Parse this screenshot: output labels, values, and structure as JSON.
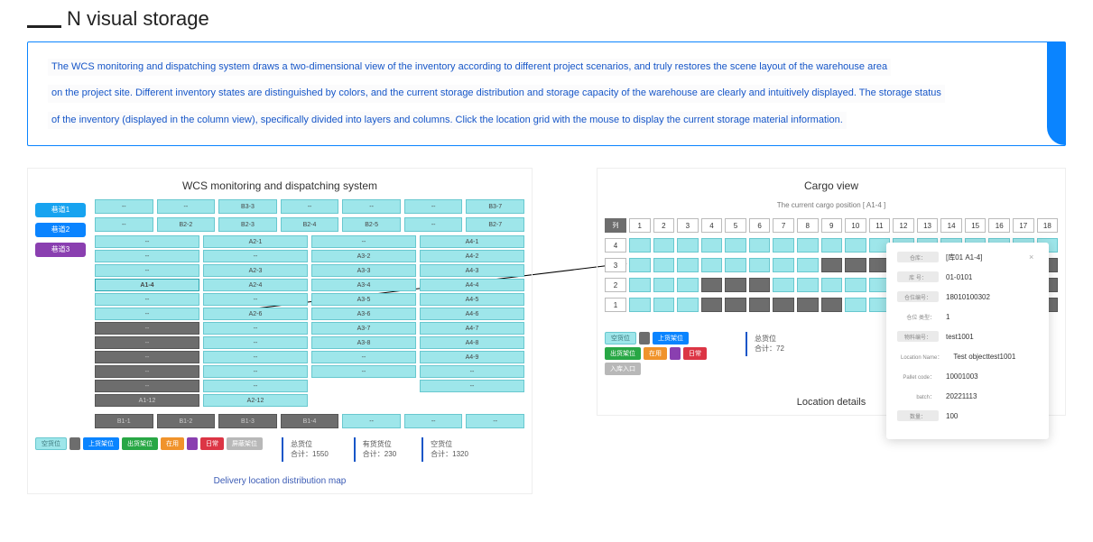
{
  "header": {
    "title": "N visual storage"
  },
  "description": {
    "line1": "The WCS monitoring and dispatching system draws a two-dimensional view of the inventory according to different project scenarios, and truly restores the scene layout of the warehouse area",
    "line2": "on the project site. Different inventory states are distinguished by colors, and the current storage distribution and storage capacity of the warehouse are clearly and intuitively displayed. The storage status",
    "line3": "of the inventory (displayed in the column view), specifically divided into layers and columns. Click the location grid with the mouse to display the current storage material information."
  },
  "left": {
    "title": "WCS monitoring and dispatching system",
    "zones": [
      "巷道1",
      "巷道2",
      "巷道3"
    ],
    "topRow1": [
      "--",
      "--",
      "B3-3",
      "--",
      "--",
      "--",
      "B3-7"
    ],
    "topRow2": [
      "--",
      "B2-2",
      "B2-3",
      "B2-4",
      "B2-5",
      "--",
      "B2-7"
    ],
    "col1": [
      "--",
      "--",
      "--",
      "A1-4",
      "--",
      "--",
      "--",
      "--",
      "--",
      "--",
      "--",
      "A1-12"
    ],
    "col1Gray": [
      false,
      false,
      false,
      false,
      false,
      false,
      true,
      true,
      true,
      true,
      true,
      true
    ],
    "col2": [
      "A2-1",
      "--",
      "A2-3",
      "A2-4",
      "--",
      "A2-6",
      "--",
      "--",
      "--",
      "--",
      "--",
      "A2-12"
    ],
    "col3": [
      "--",
      "A3-2",
      "A3-3",
      "A3-4",
      "A3-5",
      "A3-6",
      "A3-7",
      "A3-8",
      "--",
      "--"
    ],
    "col4": [
      "A4-1",
      "A4-2",
      "A4-3",
      "A4-4",
      "A4-5",
      "A4-6",
      "A4-7",
      "A4-8",
      "A4-9",
      "--",
      "--"
    ],
    "bottomRow": [
      "B1-1",
      "B1-2",
      "B1-3",
      "B1-4",
      "--",
      "--",
      "--"
    ],
    "legend": [
      "空货位",
      "",
      "上货架位",
      "出货架位",
      "在用",
      "",
      "日常",
      "屏蔽架位"
    ],
    "stats": [
      {
        "label": "总货位",
        "value": "合计：1550"
      },
      {
        "label": "有货货位",
        "value": "合计：230"
      },
      {
        "label": "空货位",
        "value": "合计：1320"
      }
    ],
    "caption": "Delivery location distribution map"
  },
  "right": {
    "title": "Cargo view",
    "subtitle": "The current cargo position [ A1-4 ]",
    "headerLabel": "列",
    "numbers": [
      "1",
      "2",
      "3",
      "4",
      "5",
      "6",
      "7",
      "8",
      "9",
      "10",
      "11",
      "12",
      "13",
      "14",
      "15",
      "16",
      "17",
      "18"
    ],
    "rows": [
      {
        "label": "4",
        "gray": [
          0,
          0,
          0,
          0,
          0,
          0,
          0,
          0,
          0,
          0,
          0,
          0,
          0,
          0,
          0,
          0,
          0,
          0
        ]
      },
      {
        "label": "3",
        "gray": [
          0,
          0,
          0,
          0,
          0,
          0,
          0,
          0,
          1,
          1,
          1,
          1,
          0,
          0,
          0,
          0,
          1,
          1
        ]
      },
      {
        "label": "2",
        "gray": [
          0,
          0,
          0,
          1,
          1,
          1,
          0,
          0,
          0,
          0,
          0,
          0,
          0,
          0,
          0,
          0,
          1,
          1
        ]
      },
      {
        "label": "1",
        "gray": [
          0,
          0,
          0,
          1,
          1,
          1,
          1,
          1,
          1,
          0,
          0,
          0,
          0,
          0,
          0,
          0,
          1,
          1
        ]
      }
    ],
    "legend": [
      "空货位",
      "",
      "上货架位",
      "出货架位",
      "在用",
      "",
      "日常",
      "入库入口"
    ],
    "stat": {
      "label": "总货位",
      "value": "合计：72"
    },
    "popup": {
      "titleLabel": "仓库：",
      "titleValue": "[库01 A1-4]",
      "rows": [
        {
          "label": "库   号：",
          "value": "01-0101"
        },
        {
          "label": "仓位编号：",
          "value": "18010100302"
        },
        {
          "labelPlain": "仓位   类型：",
          "value": "1"
        },
        {
          "label": "物料编号：",
          "value": "test1001"
        },
        {
          "labelPlain": "Location Name：",
          "value": "Test objecttest1001"
        },
        {
          "labelPlain": "Pallet code：",
          "value": "10001003"
        },
        {
          "labelPlain": "batch：",
          "value": "20221113"
        },
        {
          "label": "数量：",
          "value": "100"
        }
      ]
    },
    "caption": "Location details"
  }
}
